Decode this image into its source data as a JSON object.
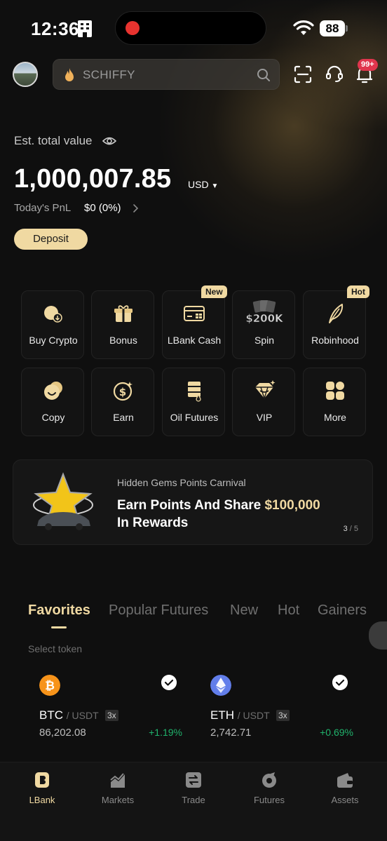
{
  "status_bar": {
    "time": "12:36",
    "battery": "88"
  },
  "header": {
    "search_placeholder": "SCHIFFY",
    "notification_badge": "99+"
  },
  "account": {
    "est_label": "Est. total value",
    "balance": "1,000,007.85",
    "currency": "USD",
    "pnl_label": "Today's PnL",
    "pnl_value": "$0 (0%)",
    "deposit_label": "Deposit"
  },
  "shortcuts": [
    {
      "label": "Buy Crypto",
      "icon": "buy-crypto-icon"
    },
    {
      "label": "Bonus",
      "icon": "gift-icon"
    },
    {
      "label": "LBank Cash",
      "icon": "card-icon",
      "tag": "New"
    },
    {
      "label": "Spin",
      "icon": "spin-prize-icon",
      "icon_text": "$200K"
    },
    {
      "label": "Robinhood",
      "icon": "feather-icon",
      "tag": "Hot"
    },
    {
      "label": "Copy",
      "icon": "copy-trade-icon"
    },
    {
      "label": "Earn",
      "icon": "dollar-coin-icon"
    },
    {
      "label": "Oil Futures",
      "icon": "oil-barrel-icon"
    },
    {
      "label": "VIP",
      "icon": "diamond-icon"
    },
    {
      "label": "More",
      "icon": "grid-icon"
    }
  ],
  "banner": {
    "subtitle": "Hidden Gems Points Carnival",
    "headline_prefix": "Earn Points And Share ",
    "headline_amount": "$100,000",
    "headline_suffix": "In Rewards",
    "page_current": "3",
    "page_total": "/ 5"
  },
  "market_tabs": [
    "Favorites",
    "Popular Futures",
    "New",
    "Hot",
    "Gainers"
  ],
  "select_token_label": "Select token",
  "favorites": [
    {
      "base": "BTC",
      "quote": "/ USDT",
      "leverage": "3x",
      "price": "86,202.08",
      "change": "+1.19%"
    },
    {
      "base": "ETH",
      "quote": "/ USDT",
      "leverage": "3x",
      "price": "2,742.71",
      "change": "+0.69%"
    }
  ],
  "nav": [
    "LBank",
    "Markets",
    "Trade",
    "Futures",
    "Assets"
  ],
  "colors": {
    "accent": "#f0d9a2",
    "positive": "#20b26c",
    "badge": "#e0354d",
    "btc": "#f7931a",
    "eth": "#627eea"
  }
}
